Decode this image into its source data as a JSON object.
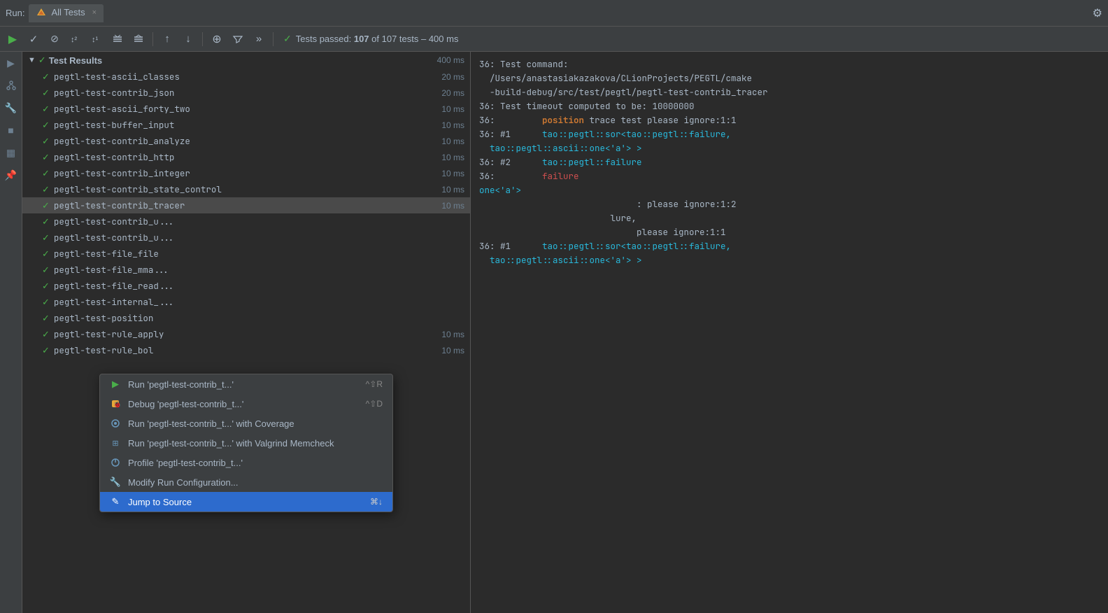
{
  "titleBar": {
    "runLabel": "Run:",
    "tabLabel": "All Tests",
    "gearIcon": "⚙"
  },
  "toolbar": {
    "buttons": [
      {
        "name": "play-button",
        "icon": "▶",
        "isPlay": true
      },
      {
        "name": "check-button",
        "icon": "✓"
      },
      {
        "name": "stop-button",
        "icon": "⊘"
      },
      {
        "name": "sort-az-button",
        "icon": "↕"
      },
      {
        "name": "sort-za-button",
        "icon": "↕"
      },
      {
        "name": "collapse-button",
        "icon": "≡"
      },
      {
        "name": "expand-button",
        "icon": "≡"
      },
      {
        "name": "up-button",
        "icon": "↑"
      },
      {
        "name": "down-button",
        "icon": "↓"
      },
      {
        "name": "search-button",
        "icon": "⊕"
      },
      {
        "name": "filter-button",
        "icon": "⌖"
      },
      {
        "name": "more-button",
        "icon": "»"
      }
    ],
    "status": {
      "check": "✓",
      "text": "Tests passed:",
      "boldPart": "107",
      "rest": "of 107 tests – 400 ms"
    }
  },
  "sideIcons": [
    {
      "name": "run-icon",
      "icon": "▶"
    },
    {
      "name": "git-icon",
      "icon": "⎇"
    },
    {
      "name": "build-icon",
      "icon": "🔧"
    },
    {
      "name": "stop-square-icon",
      "icon": "■"
    },
    {
      "name": "layout-icon",
      "icon": "▦"
    },
    {
      "name": "pin-icon",
      "icon": "📌"
    }
  ],
  "testPanel": {
    "groupHeader": {
      "chevron": "▼",
      "check": "✓",
      "label": "Test Results",
      "time": "400 ms"
    },
    "tests": [
      {
        "name": "pegtl-test-ascii_classes",
        "time": "20 ms",
        "selected": false
      },
      {
        "name": "pegtl-test-contrib_json",
        "time": "20 ms",
        "selected": false
      },
      {
        "name": "pegtl-test-ascii_forty_two",
        "time": "10 ms",
        "selected": false
      },
      {
        "name": "pegtl-test-buffer_input",
        "time": "10 ms",
        "selected": false
      },
      {
        "name": "pegtl-test-contrib_analyze",
        "time": "10 ms",
        "selected": false
      },
      {
        "name": "pegtl-test-contrib_http",
        "time": "10 ms",
        "selected": false
      },
      {
        "name": "pegtl-test-contrib_integer",
        "time": "10 ms",
        "selected": false
      },
      {
        "name": "pegtl-test-contrib_state_control",
        "time": "10 ms",
        "selected": false
      },
      {
        "name": "pegtl-test-contrib_tracer",
        "time": "10 ms",
        "selected": true
      },
      {
        "name": "pegtl-test-contrib_u...",
        "time": "",
        "selected": false
      },
      {
        "name": "pegtl-test-contrib_u...",
        "time": "",
        "selected": false
      },
      {
        "name": "pegtl-test-file_file",
        "time": "",
        "selected": false
      },
      {
        "name": "pegtl-test-file_mma...",
        "time": "",
        "selected": false
      },
      {
        "name": "pegtl-test-file_read...",
        "time": "",
        "selected": false
      },
      {
        "name": "pegtl-test-internal_...",
        "time": "",
        "selected": false
      },
      {
        "name": "pegtl-test-position",
        "time": "",
        "selected": false
      },
      {
        "name": "pegtl-test-rule_apply",
        "time": "10 ms",
        "selected": false
      },
      {
        "name": "pegtl-test-rule_bol",
        "time": "10 ms",
        "selected": false
      }
    ]
  },
  "outputPanel": {
    "lines": [
      {
        "num": "36:",
        "text": " Test command:"
      },
      {
        "num": "",
        "text": "  /Users/anastasiakazakova/CLionProjects/PEGTL/cmake"
      },
      {
        "num": "",
        "text": "  -build-debug/src/test/pegtl/pegtl-test-contrib_tracer"
      },
      {
        "num": "36:",
        "text": " Test timeout computed to be: 10000000"
      },
      {
        "num": "36:",
        "text": "         ",
        "keyword": "position",
        "rest": " trace test please ignore:1:1"
      },
      {
        "num": "36: #1",
        "text": "      ",
        "cyan": "tao::pegtl::sor<tao::pegtl::failure,"
      },
      {
        "num": "",
        "text": "  ",
        "cyan": "tao::pegtl::ascii::one<'a'> >"
      },
      {
        "num": "36: #2",
        "text": "      ",
        "cyan": "tao::pegtl::failure"
      },
      {
        "num": "36:",
        "text": "         ",
        "red": "failure"
      }
    ]
  },
  "contextMenu": {
    "items": [
      {
        "icon": "▶",
        "label": "Run 'pegtl-test-contrib_t...'",
        "shortcut": "^⇧R",
        "active": false,
        "iconColor": "green"
      },
      {
        "icon": "🐛",
        "label": "Debug 'pegtl-test-contrib_t...'",
        "shortcut": "^⇧D",
        "active": false,
        "iconColor": "orange"
      },
      {
        "icon": "◎",
        "label": "Run 'pegtl-test-contrib_t...' with Coverage",
        "shortcut": "",
        "active": false,
        "iconColor": "blue"
      },
      {
        "icon": "✦",
        "label": "Run 'pegtl-test-contrib_t...' with Valgrind Memcheck",
        "shortcut": "",
        "active": false,
        "iconColor": "blue"
      },
      {
        "icon": "◑",
        "label": "Profile 'pegtl-test-contrib_t...'",
        "shortcut": "",
        "active": false,
        "iconColor": "blue"
      },
      {
        "icon": "🔧",
        "label": "Modify Run Configuration...",
        "shortcut": "",
        "active": false,
        "iconColor": "gray"
      },
      {
        "icon": "✎",
        "label": "Jump to Source",
        "shortcut": "⌘↓",
        "active": true,
        "iconColor": "white"
      }
    ]
  }
}
